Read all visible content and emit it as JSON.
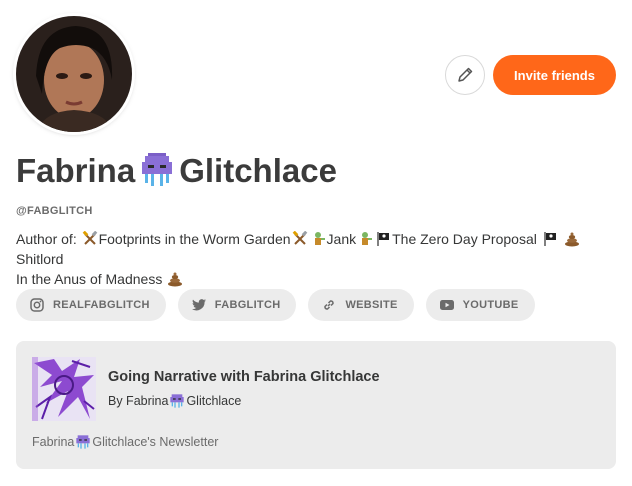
{
  "profile": {
    "name_first": "Fabrina",
    "name_last": "Glitchlace",
    "handle": "@FABGLITCH",
    "bio": {
      "prefix": "Author of: ",
      "work1": "Footprints in the Worm Garden",
      "work2": "Jank",
      "work3": "The Zero Day Proposal",
      "work4": "Shitlord",
      "line2": "In the Anus of Madness"
    }
  },
  "actions": {
    "invite_label": "Invite friends"
  },
  "social": [
    {
      "label": "REALFABGLITCH",
      "icon": "instagram-icon"
    },
    {
      "label": "FABGLITCH",
      "icon": "twitter-icon"
    },
    {
      "label": "WEBSITE",
      "icon": "link-icon"
    },
    {
      "label": "YOUTUBE",
      "icon": "youtube-icon"
    }
  ],
  "publication": {
    "title": "Going Narrative with Fabrina Glitchlace",
    "by_prefix": "By Fabrina",
    "by_suffix": "Glitchlace",
    "newsletter_prefix": "Fabrina",
    "newsletter_suffix": "Glitchlace's Newsletter"
  },
  "colors": {
    "accent": "#ff6719",
    "pill_bg": "#ececec",
    "text": "#363737",
    "muted": "#6b6b6b"
  }
}
